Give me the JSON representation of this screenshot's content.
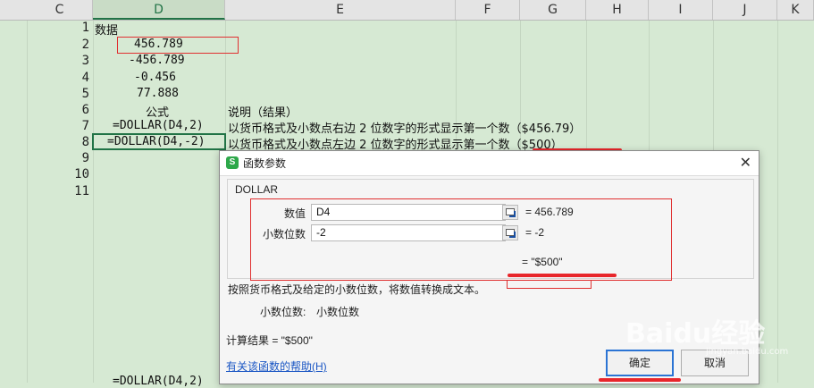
{
  "columns": [
    "C",
    "D",
    "E",
    "F",
    "G",
    "H",
    "I",
    "J",
    "K"
  ],
  "rows": [
    "1",
    "2",
    "3",
    "4",
    "5",
    "6",
    "7",
    "8",
    "9",
    "10",
    "11"
  ],
  "cells": {
    "d1": "数据",
    "d2": "456.789",
    "d3": "-456.789",
    "d4": "-0.456",
    "d5": "77.888",
    "d6": "公式",
    "d7": "=DOLLAR(D4,2)",
    "d8": "=DOLLAR(D4,-2)",
    "e6": "说明（结果）",
    "e7": "以货币格式及小数点右边 2 位数字的形式显示第一个数（$456.79）",
    "e8": "以货币格式及小数点左边 2 位数字的形式显示第一个数（$500）",
    "bottom_partial": "=DOLLAR(D4,2)"
  },
  "dialog": {
    "title": "函数参数",
    "close": "✕",
    "function_name": "DOLLAR",
    "args": [
      {
        "label": "数值",
        "value": "D4",
        "result": "= 456.789"
      },
      {
        "label": "小数位数",
        "value": "-2",
        "result": "= -2"
      }
    ],
    "formula_result": "= \"$500\"",
    "description": "按照货币格式及给定的小数位数，将数值转换成文本。",
    "arg_desc_label": "小数位数:",
    "arg_desc_text": "小数位数",
    "calc_label": "计算结果  =  \"$500\"",
    "help_link": "有关该函数的帮助(H)",
    "ok": "确定",
    "cancel": "取消"
  },
  "watermark": "Baidu经验",
  "watermark_sub": "jingyan.baidu.com",
  "colors": {
    "sheet_bg": "#d6e9d3",
    "select_green": "#217346",
    "annotation_red": "#e03030",
    "link_blue": "#1a56c4"
  }
}
